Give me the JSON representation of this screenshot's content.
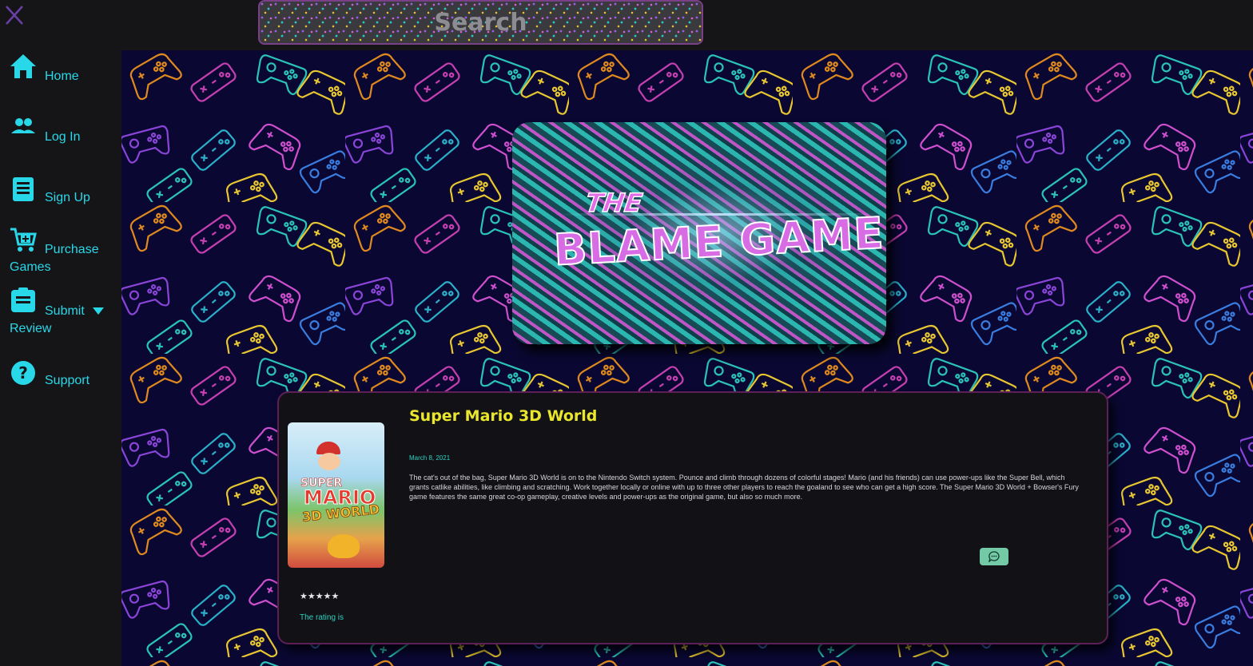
{
  "topbar": {
    "close_icon": "close-x-icon",
    "search": {
      "placeholder": "Search",
      "value": ""
    }
  },
  "sidebar": {
    "items": [
      {
        "icon": "home-icon",
        "label": "Home"
      },
      {
        "icon": "users-icon",
        "label": "Log In"
      },
      {
        "icon": "document-icon",
        "label": "Sign Up"
      },
      {
        "icon": "cart-add-icon",
        "label": "Purchase",
        "label_line2": "Games"
      },
      {
        "icon": "review-icon",
        "label": "Submit",
        "label_line2": "Review",
        "dropdown_icon": "caret-down-icon"
      },
      {
        "icon": "help-icon",
        "label": "Support"
      }
    ]
  },
  "banner": {
    "title_top": "THE",
    "title_main": "BLAME GAME"
  },
  "review": {
    "cover_text_1": "SUPER",
    "cover_text_2": "MARIO",
    "cover_text_3": "3D WORLD",
    "title": "Super Mario 3D World",
    "date": "March 8, 2021",
    "description": "The cat's out of the bag, Super Mario 3D World  is on to the Nintendo Switch system. Pounce and climb through dozens of colorful stages! Mario (and his friends) can use power-ups like the Super Bell, which grants catlike abilities, like climbing and scratching. Work together locally or online with up to three other players to reach the goaland to see who can get a high score. The Super Mario 3D World + Bowser's Fury game features the same great co-op gameplay, creative levels and power-ups as the original game, but also so much more.",
    "stars": "★★★★★",
    "rating_text": "The rating is",
    "comment_icon": "comment-icon"
  },
  "colors": {
    "accent": "#29d8e8",
    "title": "#e9e62d",
    "date": "#2bd1c1",
    "card_border": "#5e1f57",
    "background": "#0a0833"
  }
}
